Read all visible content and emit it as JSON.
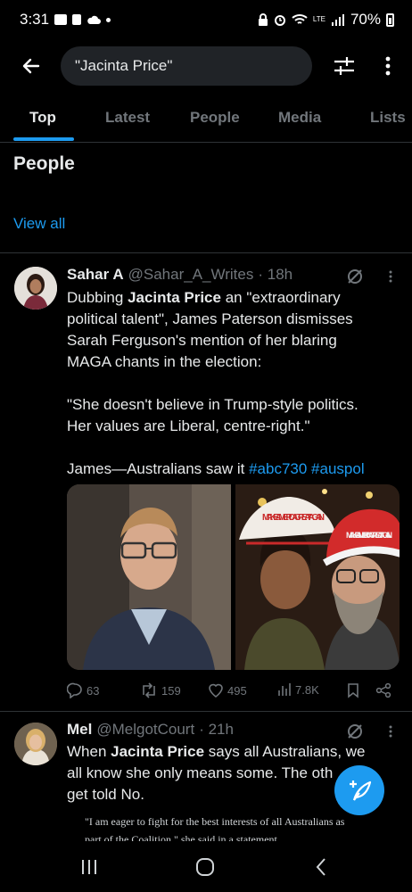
{
  "status_bar": {
    "time": "3:31",
    "battery": "70%",
    "network_label": "LTE"
  },
  "search": {
    "query": "\"Jacinta Price\""
  },
  "tabs": [
    {
      "label": "Top",
      "active": true
    },
    {
      "label": "Latest",
      "active": false
    },
    {
      "label": "People",
      "active": false
    },
    {
      "label": "Media",
      "active": false
    },
    {
      "label": "Lists",
      "active": false
    }
  ],
  "people_section": {
    "heading": "People",
    "view_all": "View all"
  },
  "tweets": [
    {
      "name": "Sahar A",
      "handle": "@Sahar_A_Writes",
      "time": "· 18h",
      "text_lines": [
        [
          "Dubbing ",
          "Jacinta Price",
          " an \"extraordinary"
        ],
        [
          "political talent\", James Paterson dismisses"
        ],
        [
          "Sarah Ferguson's mention of her blaring"
        ],
        [
          "MAGA chants in the election:"
        ],
        [
          ""
        ],
        [
          "\"She doesn't believe in Trump-style politics."
        ],
        [
          "Her values are Liberal, centre-right.\""
        ],
        [
          ""
        ],
        [
          "James—Australians saw it ",
          "#abc730",
          " ",
          "#auspol"
        ]
      ],
      "hat_text_left": "MAKE AMERICA GREAT AGAIN",
      "hat_text_right": "MAKE AMERICA GREAT AGAIN",
      "replies": "63",
      "reposts": "159",
      "likes": "495",
      "views": "7.8K"
    },
    {
      "name": "Mel",
      "handle": "@MelgotCourt",
      "time": "· 21h",
      "line1_pre": "When ",
      "line1_bold": "Jacinta Price",
      "line1_post": " says all Australians, we",
      "line2": "all know she only means some. The oth",
      "line3": "get told No.",
      "quote_line1": "\"I am eager to fight for the best interests of all Australians as",
      "quote_line2": "part of the Coalition,\" she said in a statement"
    }
  ],
  "colors": {
    "accent": "#1d9bf0",
    "background": "#000000",
    "secondary_text": "#71767b"
  }
}
